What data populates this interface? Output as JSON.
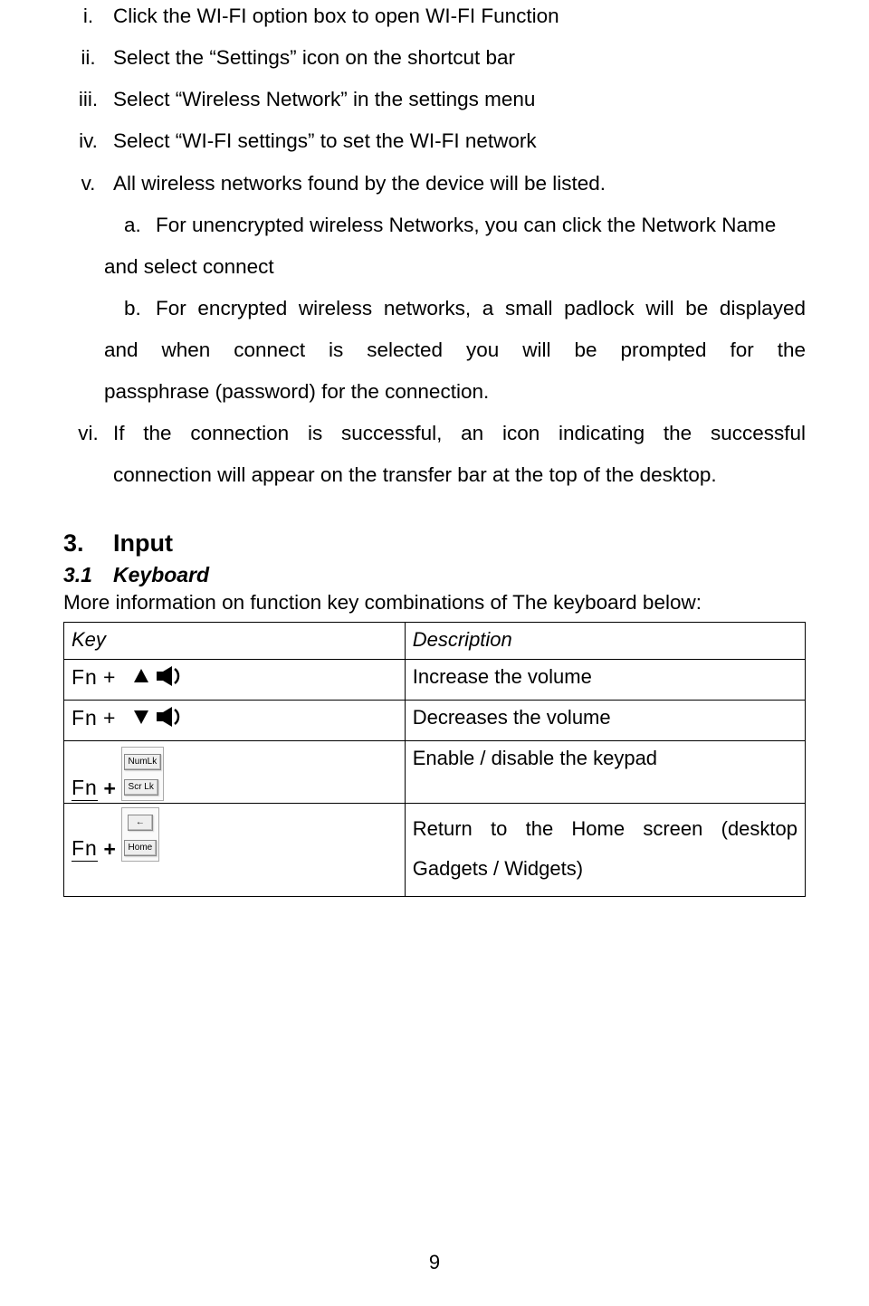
{
  "list": {
    "i": {
      "marker": "i.",
      "text": "Click the WI-FI option box to open WI-FI Function"
    },
    "ii": {
      "marker": "ii.",
      "text": "Select the “Settings” icon on the shortcut bar"
    },
    "iii": {
      "marker": "iii.",
      "text": "Select “Wireless Network” in the settings menu"
    },
    "iv": {
      "marker": "iv.",
      "text": "Select “WI-FI settings” to set the WI-FI network"
    },
    "v": {
      "marker": "v.",
      "text": "All wireless networks found by the device will be listed."
    },
    "a": {
      "marker": "a.",
      "line1": "For unencrypted wireless Networks, you can click the Network Name",
      "line2": "and select connect"
    },
    "b": {
      "marker": "b.",
      "line1": "For encrypted wireless networks, a small padlock will be displayed",
      "line2": "and when connect is selected you will be prompted for the",
      "line3": "passphrase (password) for the connection."
    },
    "vi": {
      "marker": "vi.",
      "line1": "If the connection is successful, an icon indicating the successful",
      "line2": "connection will appear on the transfer bar at the top of the desktop."
    }
  },
  "section": {
    "num": "3.",
    "title": "Input",
    "subnum": "3.1",
    "subtitle": "Keyboard",
    "intro": "More information on function key combinations of The keyboard below:"
  },
  "table": {
    "header": {
      "key": "Key",
      "desc": "Description"
    },
    "rows": {
      "r1": {
        "fn": "Fn",
        "plus": "+",
        "icon": "up-volume",
        "desc": "Increase the volume"
      },
      "r2": {
        "fn": "Fn",
        "plus": "+",
        "icon": "down-volume",
        "desc": "Decreases the volume"
      },
      "r3": {
        "fn": "Fn",
        "plus": "+",
        "key1": "NumLk",
        "key2": "Scr Lk",
        "desc": "Enable / disable the keypad"
      },
      "r4": {
        "fn": "Fn",
        "plus": "+",
        "key1": "←",
        "key2": "Home",
        "desc1": "Return to the Home screen (desktop",
        "desc2": "Gadgets / Widgets)"
      }
    }
  },
  "page_number": "9"
}
